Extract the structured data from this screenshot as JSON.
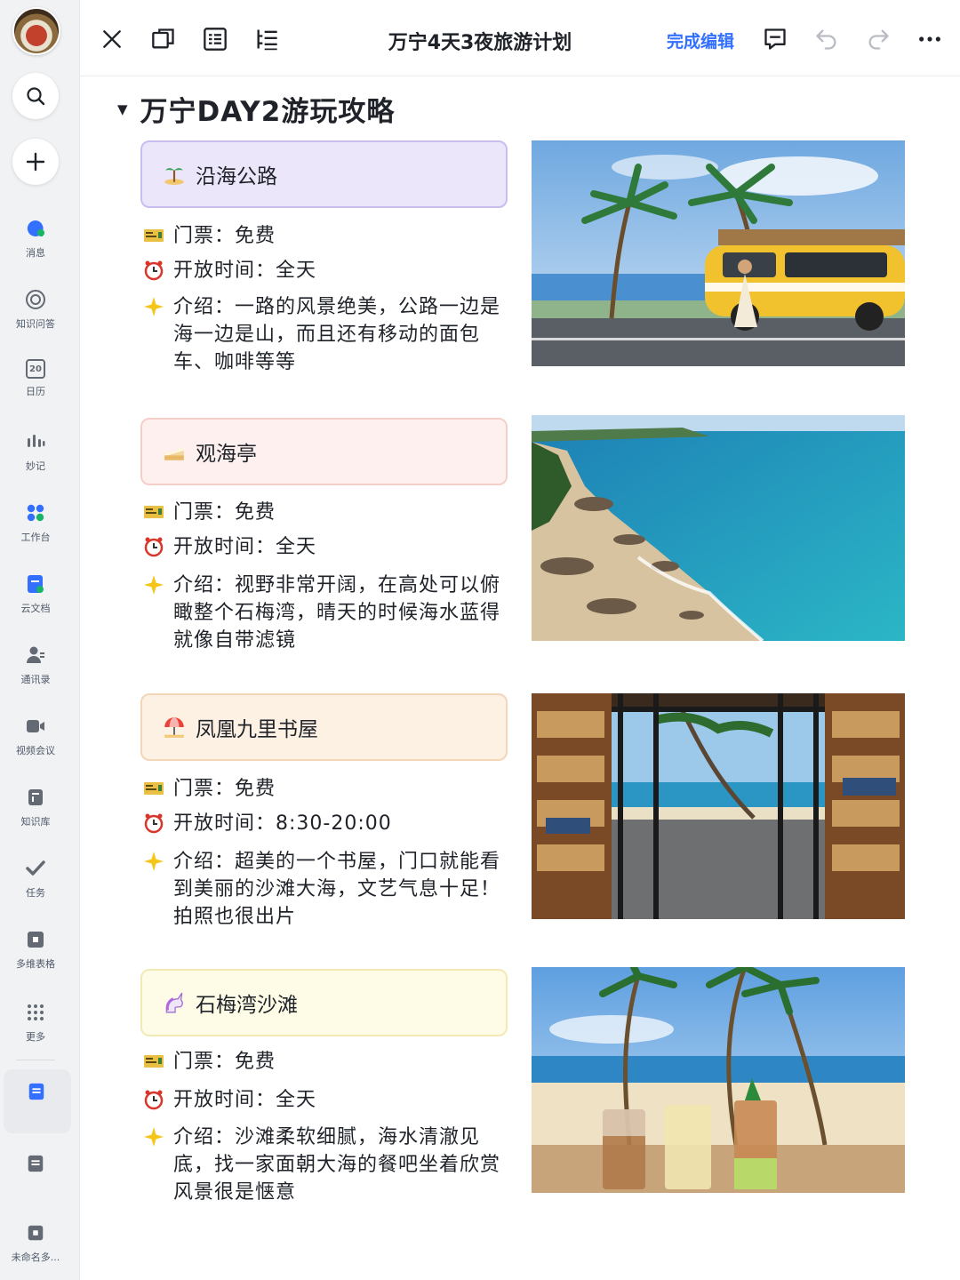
{
  "sidebar": {
    "items": [
      {
        "label": "消息"
      },
      {
        "label": "知识问答"
      },
      {
        "label": "日历",
        "day": "20"
      },
      {
        "label": "妙记"
      },
      {
        "label": "工作台"
      },
      {
        "label": "云文档"
      },
      {
        "label": "通讯录"
      },
      {
        "label": "视频会议"
      },
      {
        "label": "知识库"
      },
      {
        "label": "任务"
      },
      {
        "label": "多维表格"
      },
      {
        "label": "更多"
      }
    ],
    "bottom_item_label": "未命名多..."
  },
  "toolbar": {
    "title": "万宁4天3夜旅游计划",
    "finish_label": "完成编辑"
  },
  "colors": {
    "accent": "#3370ff",
    "card_purple": "#ece6fb",
    "card_pink": "#fdf0ee",
    "card_orange": "#fdf1e4",
    "card_yellow": "#fefbe6"
  },
  "document": {
    "heading": "万宁DAY2游玩攻略",
    "spots": [
      {
        "name": "沿海公路",
        "emoji": "palm-island-icon",
        "ticket": "门票：免费",
        "hours": "开放时间：全天",
        "intro": "介绍：一路的风景绝美，公路一边是海一边是山，而且还有移动的面包车、咖啡等等",
        "photo": "coastal road with yellow van and palm trees"
      },
      {
        "name": "观海亭",
        "emoji": "cake-icon",
        "ticket": "门票：免费",
        "hours": "开放时间：全天",
        "intro": "介绍：视野非常开阔，在高处可以俯瞰整个石梅湾，晴天的时候海水蓝得就像自带滤镜",
        "photo": "rocky coastline with turquoise sea"
      },
      {
        "name": "凤凰九里书屋",
        "emoji": "beach-umbrella-icon",
        "ticket": "门票：免费",
        "hours": "开放时间：8:30-20:00",
        "intro": "介绍：超美的一个书屋，门口就能看到美丽的沙滩大海，文艺气息十足！拍照也很出片",
        "photo": "bookstore doorway opening to the beach"
      },
      {
        "name": "石梅湾沙滩",
        "emoji": "unicorn-icon",
        "ticket": "门票：免费",
        "hours": "开放时间：全天",
        "intro": "介绍：沙滩柔软细腻，海水清澈见底，找一家面朝大海的餐吧坐着欣赏风景很是惬意",
        "photo": "beach with palm trees and iced drinks"
      }
    ]
  }
}
